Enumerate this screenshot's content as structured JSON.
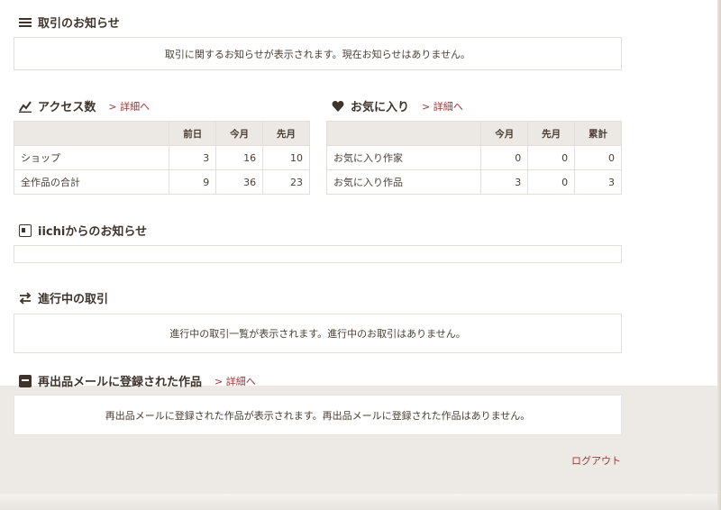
{
  "notices": {
    "title": "取引のお知らせ",
    "message": "取引に関するお知らせが表示されます。現在お知らせはありません。"
  },
  "access": {
    "title": "アクセス数",
    "detail_link": "> 詳細へ",
    "headers": [
      "前日",
      "今月",
      "先月"
    ],
    "rows": [
      {
        "label": "ショップ",
        "values": [
          "3",
          "16",
          "10"
        ]
      },
      {
        "label": "全作品の合計",
        "values": [
          "9",
          "36",
          "23"
        ]
      }
    ]
  },
  "favorites": {
    "title": "お気に入り",
    "detail_link": "> 詳細へ",
    "headers": [
      "今月",
      "先月",
      "累計"
    ],
    "rows": [
      {
        "label": "お気に入り作家",
        "values": [
          "0",
          "0",
          "0"
        ]
      },
      {
        "label": "お気に入り作品",
        "values": [
          "3",
          "0",
          "3"
        ]
      }
    ]
  },
  "iichi_notices": {
    "title": "iichiからのお知らせ"
  },
  "ongoing": {
    "title": "進行中の取引",
    "message": "進行中の取引一覧が表示されます。進行中のお取引はありません。"
  },
  "restock": {
    "title": "再出品メールに登録された作品",
    "detail_link": "> 詳細へ",
    "message": "再出品メールに登録された作品が表示されます。再出品メールに登録された作品はありません。"
  },
  "logout_label": "ログアウト",
  "colors": {
    "accent": "#a0373a",
    "heading": "#3e342b",
    "table_header": "#ece8e4",
    "border": "#e3ded8",
    "footer_band": "#edeae6"
  }
}
